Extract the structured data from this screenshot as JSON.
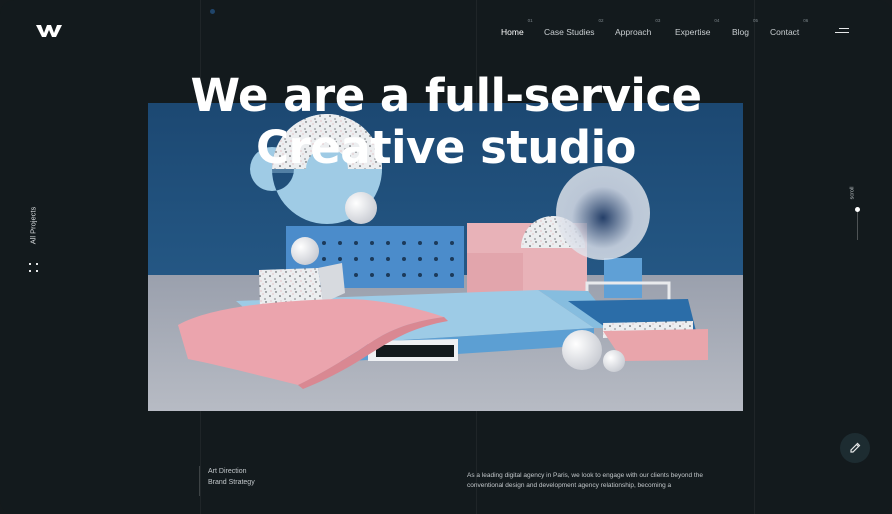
{
  "nav": {
    "items": [
      {
        "num": "01",
        "label": "Home",
        "active": true
      },
      {
        "num": "02",
        "label": "Case Studies",
        "active": false
      },
      {
        "num": "03",
        "label": "Approach",
        "active": false
      },
      {
        "num": "04",
        "label": "Expertise",
        "active": false
      },
      {
        "num": "05",
        "label": "Blog",
        "active": false
      },
      {
        "num": "06",
        "label": "Contact",
        "active": false
      }
    ]
  },
  "hero": {
    "line1": "We are a full-service",
    "line2": "Creative studio"
  },
  "sidebar": {
    "all_projects": "All Projects",
    "scroll": "scroll"
  },
  "services": [
    "Art Direction",
    "Brand Strategy"
  ],
  "about": "As a leading digital agency in Paris, we look to engage with our clients beyond the conventional design and development agency relationship, becoming a",
  "colors": {
    "background": "#131a1d",
    "scene_blue": "#1f4f78",
    "scene_floor": "#a9adb7",
    "pastel_pink": "#e9a5ab",
    "pastel_blue": "#8fc3e0",
    "accent_blue": "#3d86c6"
  },
  "icons": {
    "logo": "w-logo",
    "menu": "hamburger-icon",
    "grid": "grid-icon",
    "edit": "pencil-icon"
  }
}
